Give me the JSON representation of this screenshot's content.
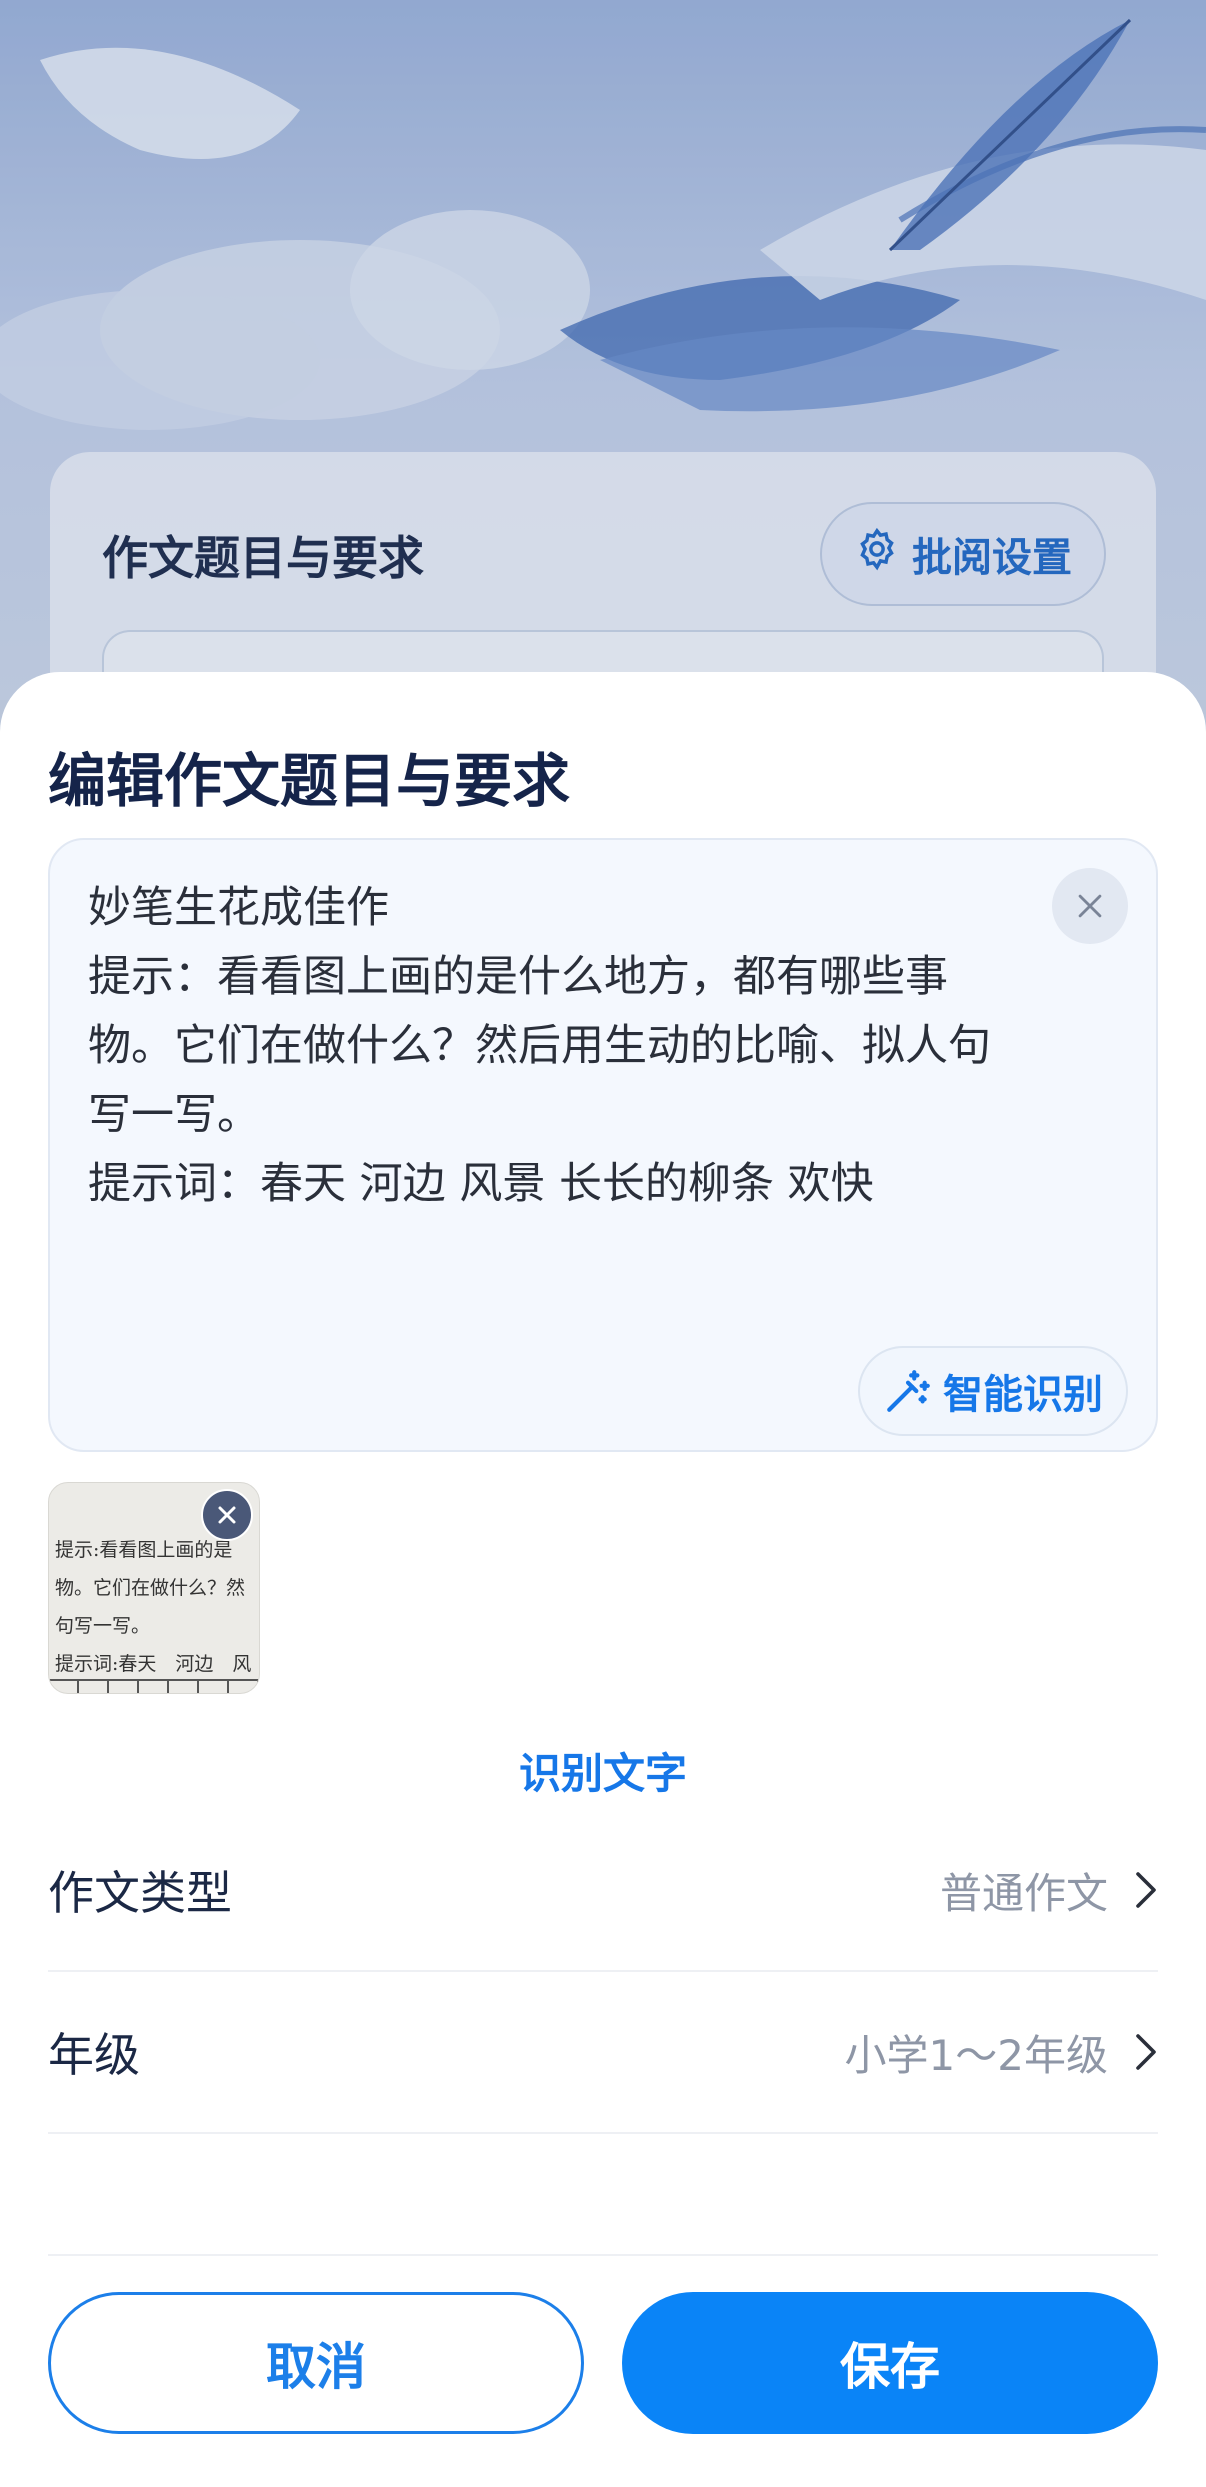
{
  "background": {
    "card_title": "作文题目与要求",
    "settings_button_label": "批阅设置",
    "settings_icon": "gear-icon"
  },
  "sheet": {
    "title": "编辑作文题目与要求",
    "topic_text": {
      "lines": [
        "妙笔生花成佳作",
        "提示：看看图上画的是什么地方，都有哪些事",
        "物。它们在做什么？然后用生动的比喻、拟人句",
        "写一写。",
        "提示词：春天 河边 风景 长长的柳条 欢快"
      ],
      "clear_icon": "close-icon"
    },
    "smart_button": {
      "label": "智能识别",
      "icon": "magic-wand-icon"
    },
    "thumbnail": {
      "lines": [
        "提示:看看图上画的是",
        "物。它们在做什么？然",
        "句写一写。",
        "提示词:春天　河边　风"
      ],
      "remove_icon": "close-icon"
    },
    "recognize_link": "识别文字",
    "rows": [
      {
        "label": "作文类型",
        "value": "普通作文"
      },
      {
        "label": "年级",
        "value": "小学1～2年级"
      }
    ],
    "cancel_label": "取消",
    "save_label": "保存"
  },
  "colors": {
    "accent": "#0a84f7",
    "title": "#15244a",
    "secondary_text": "#8e96a6"
  }
}
